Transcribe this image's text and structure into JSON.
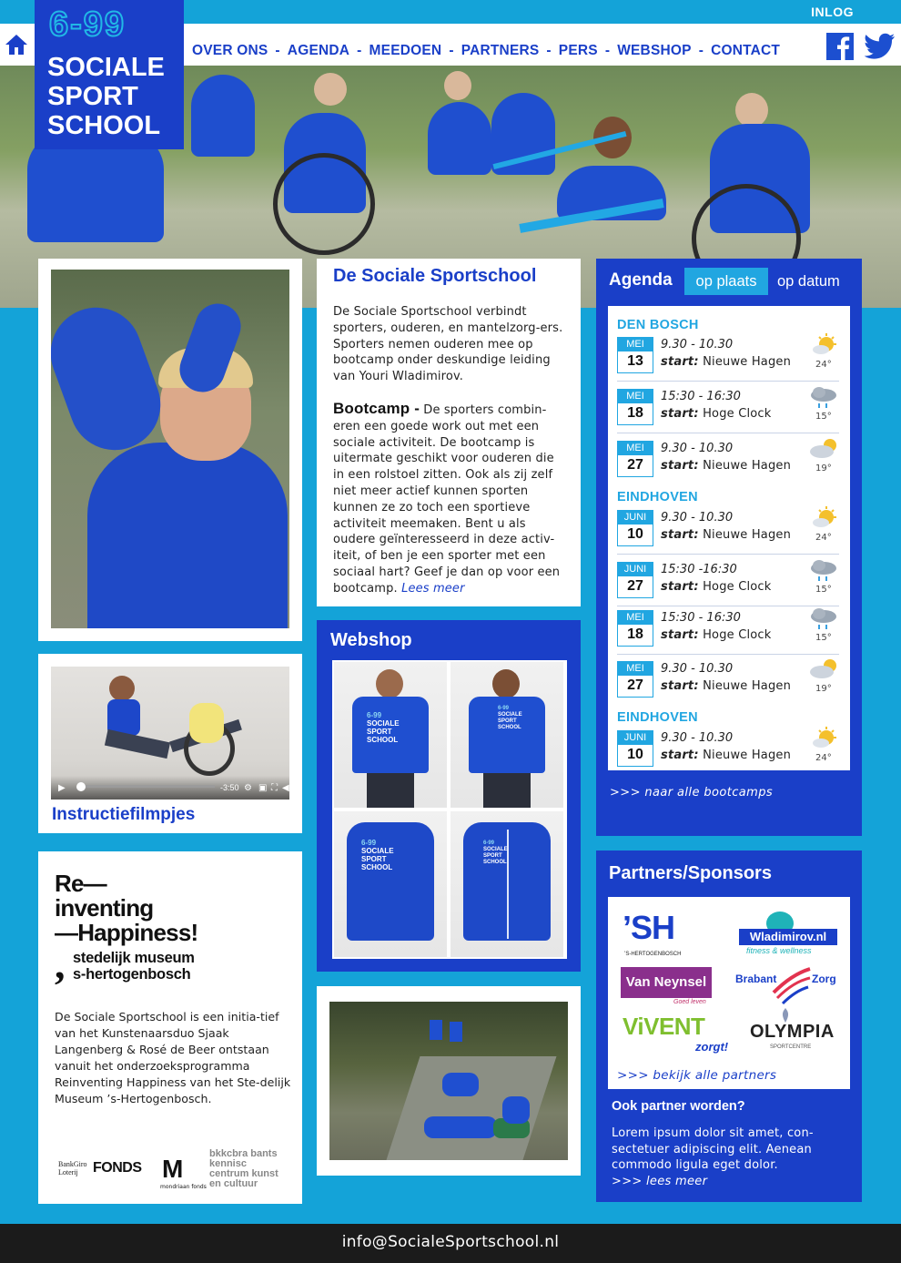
{
  "topbar": {
    "login": "INLOG"
  },
  "logo": {
    "number": "6-99",
    "line1": "SOCIALE",
    "line2": "SPORT",
    "line3": "SCHOOL"
  },
  "nav": {
    "items": [
      "OVER ONS",
      "AGENDA",
      "MEEDOEN",
      "PARTNERS",
      "PERS",
      "WEBSHOP",
      "CONTACT"
    ],
    "separator": "-"
  },
  "intro": {
    "title": "De Sociale Sportschool",
    "paragraph": "De Sociale Sportschool verbindt sporters, ouderen, en mantelzorg-ers. Sporters nemen ouderen mee op bootcamp onder deskundige leiding van Youri Wladimirov.",
    "bootcamp_title": "Bootcamp -",
    "bootcamp_text": " De sporters combin-eren een goede work out met een sociale activiteit. De bootcamp is uitermate geschikt voor ouderen die in een rolstoel zitten. Ook als zij zelf niet meer actief kunnen sporten kunnen ze zo toch een sportieve activiteit meemaken. Bent u als oudere geïnteresseerd in deze activ-iteit, of ben je een sporter met een sociaal hart? Geef je dan op voor een bootcamp. ",
    "read_more": "Lees meer"
  },
  "video": {
    "time": "-3:50",
    "caption": "Instructiefilmpjes"
  },
  "museum": {
    "title_lines": [
      "Re—",
      "inventing",
      "—Happiness!"
    ],
    "sub_lines": [
      "stedelijk museum",
      "s-hertogenbosch"
    ],
    "comma": ",",
    "body": "De Sociale Sportschool is een initia-tief van het Kunstenaarsduo Sjaak Langenberg & Rosé de Beer ontstaan vanuit het onderzoeksprogramma Reinventing Happiness van het Ste-delijk Museum ’s-Hertogenbosch.",
    "funds": {
      "bankgiro": "BankGiro Loterij",
      "fonds": "FONDS",
      "mondriaan_letter": "M",
      "mondriaan_name": "mondriaan fonds",
      "bkkc": "bkkcbra bants kennisc centrum kunst en cultuur"
    }
  },
  "webshop": {
    "title": "Webshop",
    "print_number": "6-99",
    "print_text": "SOCIALE SPORT SCHOOL"
  },
  "agenda": {
    "title": "Agenda",
    "tab_place": "op plaats",
    "tab_date": "op datum",
    "start_label": "start:",
    "groups": [
      {
        "city": "DEN BOSCH",
        "events": [
          {
            "month": "MEI",
            "day": "13",
            "time": "9.30 - 10.30",
            "place": "Nieuwe Hagen",
            "weather": "sunny",
            "temp": "24°"
          },
          {
            "month": "MEI",
            "day": "18",
            "time": "15:30 - 16:30",
            "place": "Hoge Clock",
            "weather": "rain",
            "temp": "15°"
          },
          {
            "month": "MEI",
            "day": "27",
            "time": "9.30 - 10.30",
            "place": "Nieuwe Hagen",
            "weather": "partly-cloudy",
            "temp": "19°"
          }
        ]
      },
      {
        "city": "EINDHOVEN",
        "events": [
          {
            "month": "JUNI",
            "day": "10",
            "time": "9.30 - 10.30",
            "place": "Nieuwe Hagen",
            "weather": "sunny",
            "temp": "24°"
          },
          {
            "month": "JUNI",
            "day": "27",
            "time": "15:30 -16:30",
            "place": "Hoge Clock",
            "weather": "rain",
            "temp": "15°"
          },
          {
            "month": "MEI",
            "day": "18",
            "time": "15:30 - 16:30",
            "place": "Hoge Clock",
            "weather": "rain",
            "temp": "15°"
          },
          {
            "month": "MEI",
            "day": "27",
            "time": "9.30 - 10.30",
            "place": "Nieuwe Hagen",
            "weather": "partly-cloudy",
            "temp": "19°"
          }
        ]
      },
      {
        "city": "EINDHOVEN",
        "events": [
          {
            "month": "JUNI",
            "day": "10",
            "time": "9.30 - 10.30",
            "place": "Nieuwe Hagen",
            "weather": "sunny",
            "temp": "24°"
          }
        ]
      }
    ],
    "all_link": ">>> naar alle bootcamps"
  },
  "partners": {
    "title": "Partners/Sponsors",
    "logos": {
      "sh_mark": "’SH",
      "sh_name": "’S-HERTOGENBOSCH",
      "wladimirov": "Wladimirov.nl",
      "wladimirov_tag": "fitness & wellness",
      "vanneynsel": "Van Neynsel",
      "vanneynsel_tag": "Goed leven",
      "brabantzorg_1": "Brabant",
      "brabantzorg_2": "Zorg",
      "vivent": "ViVENT",
      "vivent_tag": "zorgt!",
      "olympia": "OLYMPIA",
      "olympia_tag": "SPORTCENTRE"
    },
    "all_link": ">>> bekijk alle partners",
    "become_title": "Ook partner worden?",
    "become_text": "Lorem ipsum dolor sit amet, con-sectetuer adipiscing elit. Aenean commodo ligula eget dolor.",
    "read_more": ">>> lees meer"
  },
  "footer": {
    "email": "info@SocialeSportschool.nl"
  },
  "colors": {
    "brand_blue": "#1a3fc8",
    "light_blue": "#14a3d8",
    "footer": "#1b1b1b"
  }
}
